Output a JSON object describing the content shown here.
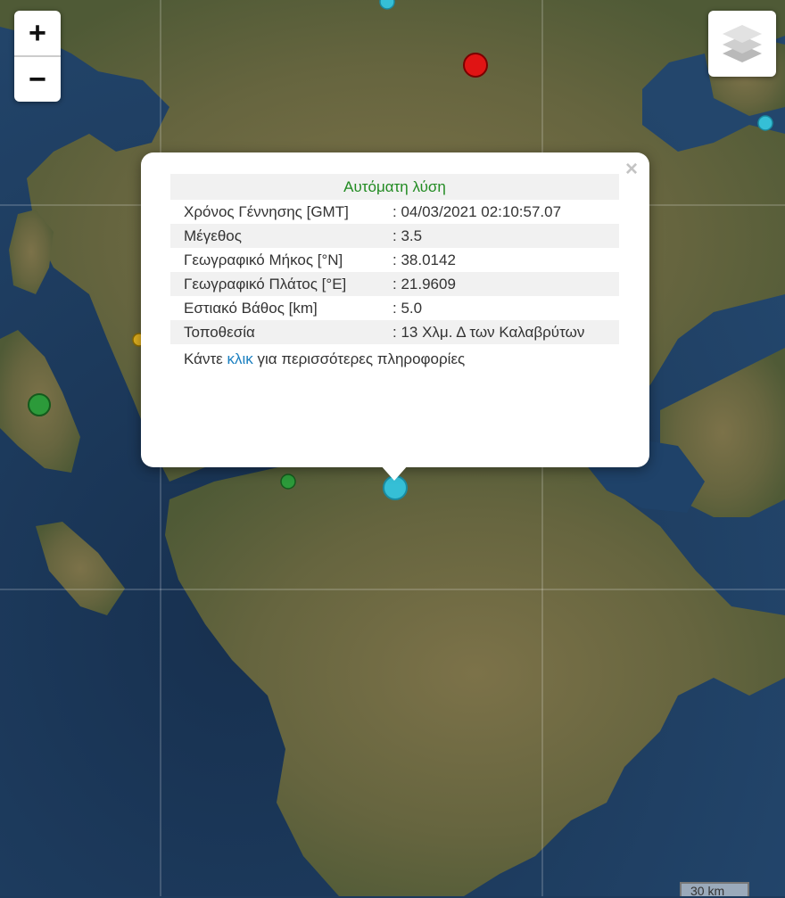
{
  "map": {
    "zoom_in_label": "+",
    "zoom_out_label": "−",
    "layers_icon": "layers-icon",
    "scale_label": "30 km",
    "colors": {
      "sea": "#1c3a5d",
      "land": "#6e6a45",
      "marker_red": "#e01414",
      "marker_cyan": "#35bfd6",
      "marker_green": "#2c9a3a",
      "marker_yellow": "#e0b020"
    }
  },
  "popup": {
    "close_label": "×",
    "header": "Αυτόματη λύση",
    "rows": [
      {
        "key": "Χρόνος Γέννησης [GMT]",
        "value": ": 04/03/2021 02:10:57.07"
      },
      {
        "key": "Μέγεθος",
        "value": ": 3.5"
      },
      {
        "key": "Γεωγραφικό Μήκος [°N]",
        "value": ": 38.0142"
      },
      {
        "key": "Γεωγραφικό Πλάτος [°E]",
        "value": ": 21.9609"
      },
      {
        "key": "Εστιακό Βάθος [km]",
        "value": ": 5.0"
      },
      {
        "key": "Τοποθεσία",
        "value": ": 13 Χλμ. Δ των Καλαβρύτων"
      }
    ],
    "more_prefix": "Κάντε ",
    "more_link": "κλικ",
    "more_suffix": " για περισσότερες πληροφορίες"
  }
}
